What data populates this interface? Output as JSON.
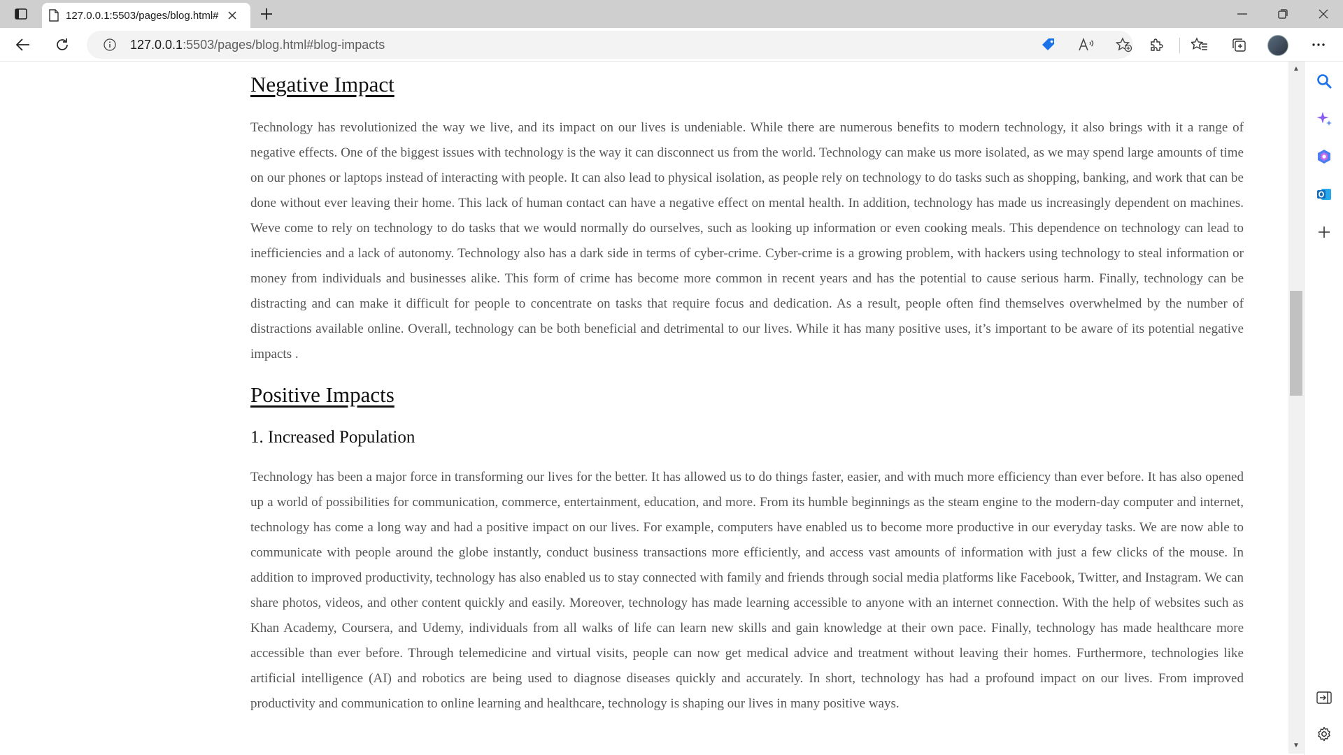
{
  "browser": {
    "tab_title": "127.0.0.1:5503/pages/blog.html#",
    "url_host": "127.0.0.1",
    "url_rest": ":5503/pages/blog.html#blog-impacts"
  },
  "article": {
    "negative_heading": "Negative Impact",
    "negative_text": "Technology has revolutionized the way we live, and its impact on our lives is undeniable. While there are numerous benefits to modern technology, it also brings with it a range of negative effects. One of the biggest issues with technology is the way it can disconnect us from the world. Technology can make us more isolated, as we may spend large amounts of time on our phones or laptops instead of interacting with people. It can also lead to physical isolation, as people rely on technology to do tasks such as shopping, banking, and work that can be done without ever leaving their home. This lack of human contact can have a negative effect on mental health. In addition, technology has made us increasingly dependent on machines. Weve come to rely on technology to do tasks that we would normally do ourselves, such as looking up information or even cooking meals. This dependence on technology can lead to inefficiencies and a lack of autonomy. Technology also has a dark side in terms of cyber-crime. Cyber-crime is a growing problem, with hackers using technology to steal information or money from individuals and businesses alike. This form of crime has become more common in recent years and has the potential to cause serious harm. Finally, technology can be distracting and can make it difficult for people to concentrate on tasks that require focus and dedication. As a result, people often find themselves overwhelmed by the number of distractions available online. Overall, technology can be both beneficial and detrimental to our lives. While it has many positive uses, it’s important to be aware of its potential negative impacts .",
    "positive_heading": "Positive Impacts",
    "subheading": "1.  Increased Population",
    "positive_text": "Technology has been a major force in transforming our lives for the better. It has allowed us to do things faster, easier, and with much more efficiency than ever before. It has also opened up a world of possibilities for communication, commerce, entertainment, education, and more. From its humble beginnings as the steam engine to the modern-day computer and internet, technology has come a long way and had a positive impact on our lives. For example, computers have enabled us to become more productive in our everyday tasks. We are now able to communicate with people around the globe instantly, conduct business transactions more efficiently, and access vast amounts of information with just a few clicks of the mouse. In addition to improved productivity, technology has also enabled us to stay connected with family and friends through social media platforms like Facebook, Twitter, and Instagram. We can share photos, videos, and other content quickly and easily. Moreover, technology has made learning accessible to anyone with an internet connection. With the help of websites such as Khan Academy, Coursera, and Udemy, individuals from all walks of life can learn new skills and gain knowledge at their own pace. Finally, technology has made healthcare more accessible than ever before. Through telemedicine and virtual visits, people can now get medical advice and treatment without leaving their homes. Furthermore, technologies like artificial intelligence (AI) and robotics are being used to diagnose diseases quickly and accurately. In short, technology has had a profound impact on our lives. From improved productivity and communication to online learning and healthcare, technology is shaping our lives in many positive ways."
  },
  "colors": {
    "accent_blue": "#1a73e8",
    "copilot_purple": "#8a5cf6",
    "outlook_blue": "#0f6cbd"
  },
  "icons": [
    "tab-actions-icon",
    "page-icon",
    "close-icon",
    "plus-icon",
    "minimize-icon",
    "restore-icon",
    "window-close-icon",
    "back-arrow-icon",
    "refresh-icon",
    "info-icon",
    "shopping-tag-icon",
    "read-aloud-icon",
    "add-favorite-icon",
    "extensions-icon",
    "favorites-icon",
    "collections-icon",
    "more-icon",
    "search-icon",
    "copilot-icon",
    "office-icon",
    "outlook-icon",
    "add-icon",
    "hide-sidebar-icon",
    "settings-icon"
  ]
}
